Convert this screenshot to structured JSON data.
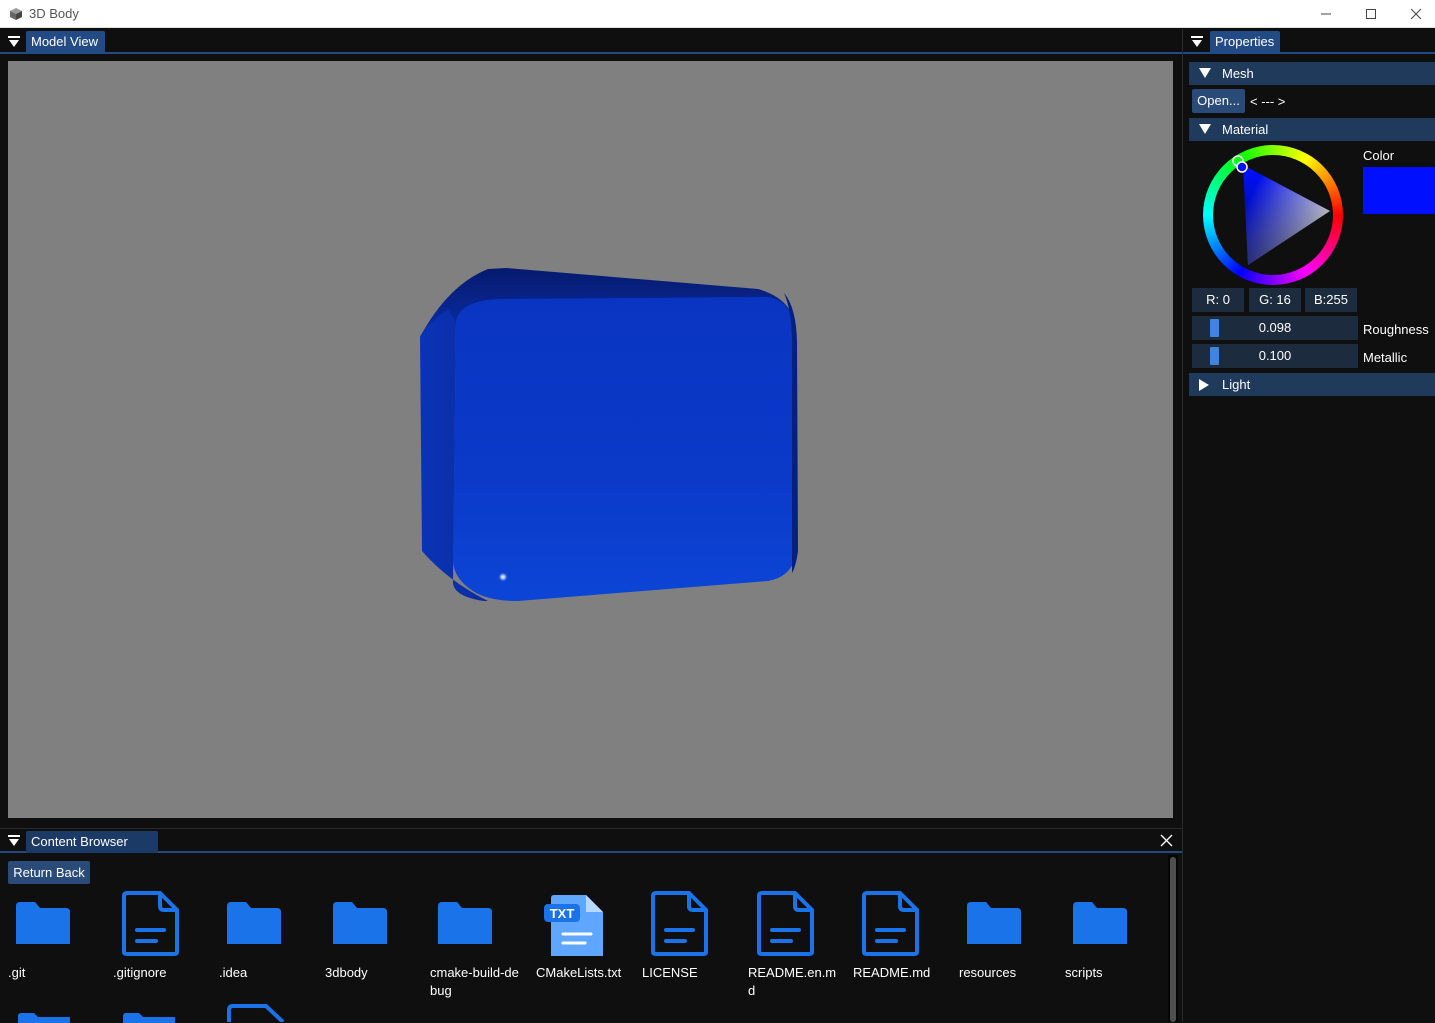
{
  "window": {
    "title": "3D Body",
    "icon": "app-cube-icon",
    "controls": [
      "minimize-icon",
      "maximize-icon",
      "close-icon"
    ]
  },
  "model_view": {
    "tab_label": "Model View",
    "background_color": "#808080",
    "object_color": "#0a2fc0"
  },
  "properties": {
    "tab_label": "Properties",
    "mesh": {
      "header": "Mesh",
      "open_button": "Open...",
      "file_name": "< --- >"
    },
    "material": {
      "header": "Material",
      "color_label": "Color",
      "color_value": "#0010ff",
      "r_field": "R:  0",
      "g_field": "G: 16",
      "b_field": "B:255",
      "roughness_value": "0.098",
      "roughness_label": "Roughness",
      "metallic_value": "0.100",
      "metallic_label": "Metallic"
    },
    "light": {
      "header": "Light"
    }
  },
  "content_browser": {
    "tab_label": "Content Browser",
    "return_button": "Return Back",
    "items": [
      {
        "name": ".git",
        "type": "folder"
      },
      {
        "name": ".gitignore",
        "type": "file"
      },
      {
        "name": ".idea",
        "type": "folder"
      },
      {
        "name": "3dbody",
        "type": "folder"
      },
      {
        "name": "cmake-build-debug",
        "type": "folder"
      },
      {
        "name": "CMakeLists.txt",
        "type": "txt"
      },
      {
        "name": "LICENSE",
        "type": "file"
      },
      {
        "name": "README.en.md",
        "type": "file"
      },
      {
        "name": "README.md",
        "type": "file"
      },
      {
        "name": "resources",
        "type": "folder"
      },
      {
        "name": "scripts",
        "type": "folder"
      }
    ]
  }
}
